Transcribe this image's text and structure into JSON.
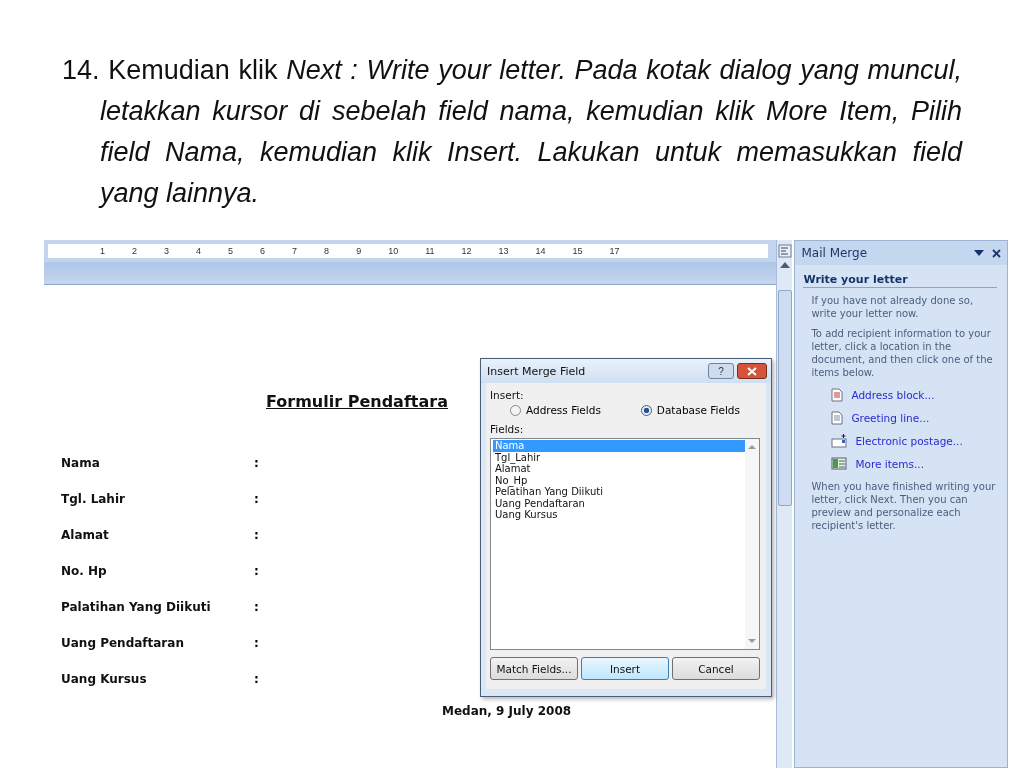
{
  "instruction": {
    "number": "14.",
    "text": "Kemudian klik *Next : Write your letter. Pada kotak dialog yang muncul, letakkan kursor di sebelah field nama, kemudian klik More Item, Pilih field Nama, kemudian klik Insert. Lakukan untuk memasukkan field yang lainnya.*"
  },
  "ruler": {
    "numbers": [
      "1",
      "2",
      "3",
      "4",
      "5",
      "6",
      "7",
      "8",
      "9",
      "10",
      "11",
      "12",
      "13",
      "14",
      "15",
      "17"
    ]
  },
  "document": {
    "title": "Formulir Pendaftara",
    "fields": [
      {
        "label": "Nama",
        "separator": ":"
      },
      {
        "label": "Tgl. Lahir",
        "separator": ":"
      },
      {
        "label": "Alamat",
        "separator": ":"
      },
      {
        "label": "No. Hp",
        "separator": ":"
      },
      {
        "label": "Palatihan Yang Diikuti",
        "separator": ":"
      },
      {
        "label": "Uang Pendaftaran",
        "separator": ":"
      },
      {
        "label": "Uang Kursus",
        "separator": ":"
      }
    ],
    "footer": "Medan, 9 July 2008"
  },
  "dialog": {
    "title": "Insert Merge Field",
    "help_button": "?",
    "insert_label": "Insert:",
    "options": [
      {
        "label": "Address Fields",
        "selected": false
      },
      {
        "label": "Database Fields",
        "selected": true
      }
    ],
    "fields_label": "Fields:",
    "fields": [
      {
        "label": "Nama",
        "selected": true
      },
      {
        "label": "Tgl_Lahir",
        "selected": false
      },
      {
        "label": "Alamat",
        "selected": false
      },
      {
        "label": "No_Hp",
        "selected": false
      },
      {
        "label": "Pelatihan Yang Diikuti",
        "selected": false
      },
      {
        "label": "Uang Pendaftaran",
        "selected": false
      },
      {
        "label": "Uang Kursus",
        "selected": false
      }
    ],
    "buttons": [
      {
        "label": "Match Fields...",
        "default": false
      },
      {
        "label": "Insert",
        "default": true
      },
      {
        "label": "Cancel",
        "default": false
      }
    ]
  },
  "task_pane": {
    "title": "Mail Merge",
    "heading": "Write your letter",
    "intro": "If you have not already done so, write your letter now.",
    "instruction": "To add recipient information to your letter, click a location in the document, and then click one of the items below.",
    "items": [
      {
        "label": "Address block...",
        "kind": "address"
      },
      {
        "label": "Greeting line...",
        "kind": "greeting"
      },
      {
        "label": "Electronic postage...",
        "kind": "postage"
      },
      {
        "label": "More items...",
        "kind": "more"
      }
    ],
    "outro": "When you have finished writing your letter, click Next. Then you can preview and personalize each recipient's letter."
  }
}
